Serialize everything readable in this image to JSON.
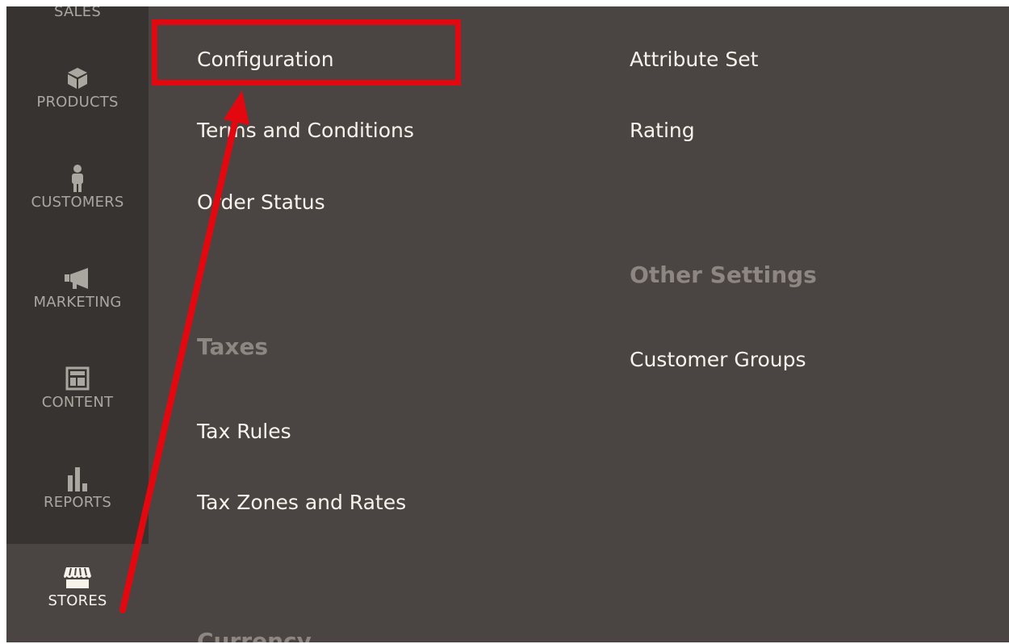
{
  "sidebar": {
    "items": [
      {
        "label": "SALES",
        "icon": "dollar-icon"
      },
      {
        "label": "PRODUCTS",
        "icon": "cube-icon"
      },
      {
        "label": "CUSTOMERS",
        "icon": "person-icon"
      },
      {
        "label": "MARKETING",
        "icon": "megaphone-icon"
      },
      {
        "label": "CONTENT",
        "icon": "layout-icon"
      },
      {
        "label": "REPORTS",
        "icon": "bar-chart-icon"
      },
      {
        "label": "STORES",
        "icon": "storefront-icon",
        "active": true
      }
    ]
  },
  "submenu": {
    "col1": {
      "links": [
        "Configuration",
        "Terms and Conditions",
        "Order Status"
      ],
      "taxes_heading": "Taxes",
      "tax_links": [
        "Tax Rules",
        "Tax Zones and Rates"
      ],
      "currency_heading": "Currency"
    },
    "col2": {
      "links": [
        "Attribute Set",
        "Rating"
      ],
      "other_heading": "Other Settings",
      "other_links": [
        "Customer Groups"
      ]
    }
  },
  "annotation": {
    "color": "#e3080f",
    "highlighted_item": "Configuration"
  }
}
